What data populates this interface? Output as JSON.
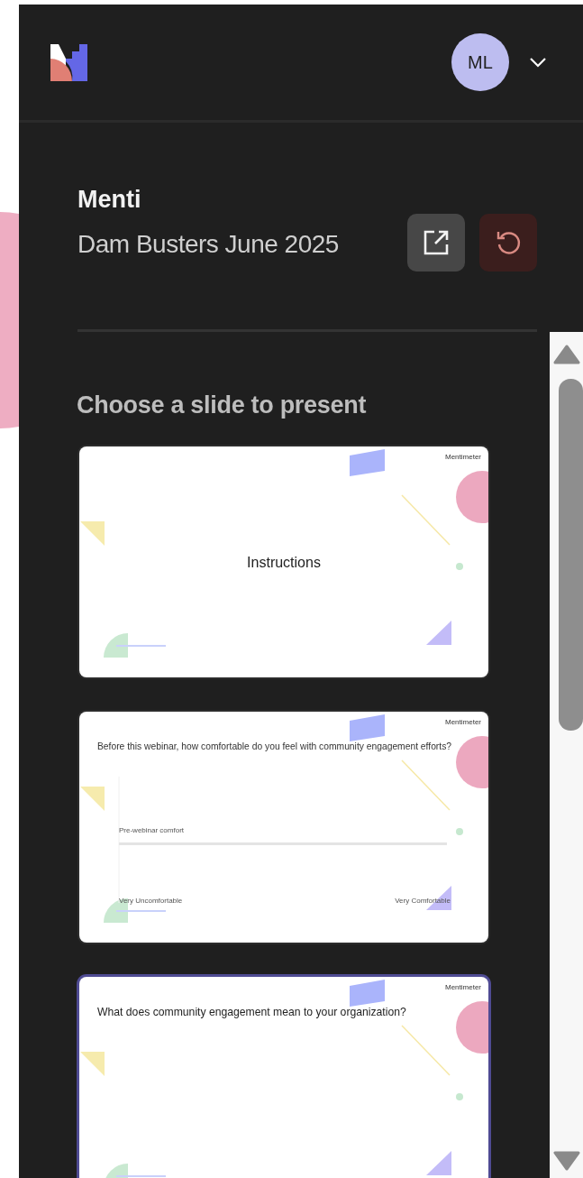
{
  "header": {
    "avatar_initials": "ML"
  },
  "presentation": {
    "workspace": "Menti",
    "title": "Dam Busters June 2025"
  },
  "slide_picker": {
    "heading": "Choose a slide to present",
    "slides": [
      {
        "kind": "title",
        "title": "Instructions",
        "brand": "Mentimeter",
        "selected": false
      },
      {
        "kind": "scale",
        "question": "Before this webinar, how comfortable do you feel with community engagement efforts?",
        "brand": "Mentimeter",
        "statement": "Pre-webinar comfort",
        "min_label": "Very Uncomfortable",
        "max_label": "Very Comfortable",
        "selected": false
      },
      {
        "kind": "question",
        "question": "What does community engagement mean to your organization?",
        "brand": "Mentimeter",
        "selected": true
      }
    ]
  }
}
